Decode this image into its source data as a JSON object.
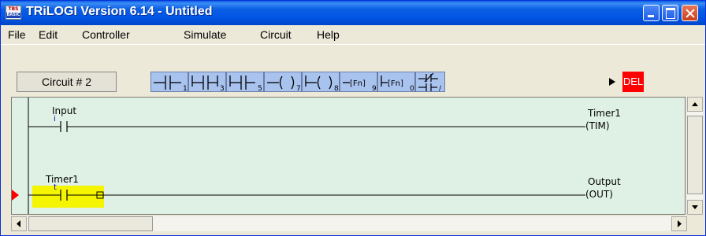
{
  "window": {
    "title": "TRiLOGI Version 6.14 - Untitled",
    "icon_top": "TBS",
    "icon_bottom": "BASIC"
  },
  "menu": [
    "File",
    "Edit",
    "Controller",
    "Simulate",
    "Circuit",
    "Help"
  ],
  "toolbar": {
    "circuit_label": "Circuit # 2",
    "tool_subscripts": [
      "1",
      "3",
      "5",
      "7",
      "8",
      "9",
      "0",
      "/"
    ],
    "fn_label": "[Fn]",
    "del_label": "DEL"
  },
  "ladder": {
    "rung1": {
      "contact_label": "Input",
      "contact_mark": "i",
      "coil_name": "Timer1",
      "coil_type": "(TIM)"
    },
    "rung2": {
      "contact_label": "Timer1",
      "contact_mark": "t",
      "coil_name": "Output",
      "coil_type": "(OUT)"
    }
  },
  "colors": {
    "title_bar": "#0054e3",
    "canvas_bg": "#dff1e4",
    "tool_bg": "#a9c3ef",
    "highlight": "#f5f500",
    "cursor_arrow": "#ff0000",
    "del_bg": "#ff0000"
  }
}
